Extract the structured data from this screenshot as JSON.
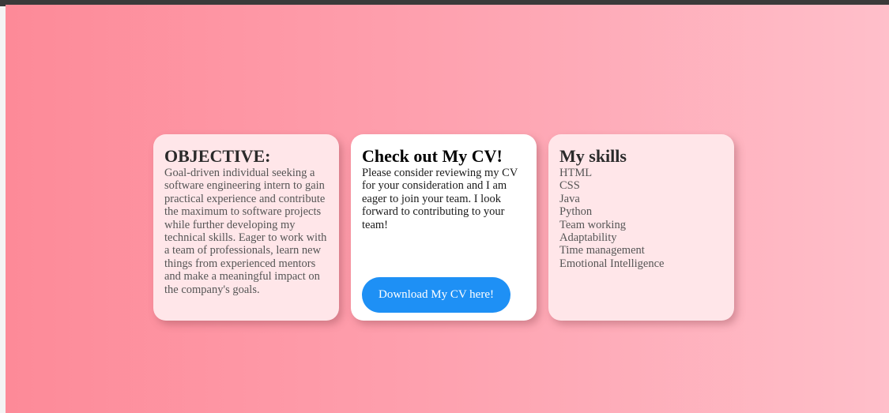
{
  "colors": {
    "background_gradient_start": "#fd8a98",
    "background_gradient_end": "#ffbfca",
    "card_pale": "#ffe6e9",
    "card_white": "#ffffff",
    "button": "#1e90f5",
    "button_text": "#ffffff"
  },
  "objective": {
    "title": "OBJECTIVE:",
    "text": "Goal-driven individual seeking a software engineering intern to gain practical experience and contribute the maximum to software projects while further developing my technical skills. Eager to work with a team of professionals, learn new things from experienced mentors and make a meaningful impact on the company's goals."
  },
  "cv": {
    "title": "Check out My CV!",
    "text": "Please consider reviewing my CV for your consideration and I am eager to join your team. I look forward to contributing to your team!",
    "button_label": "Download My CV here!"
  },
  "skills": {
    "title": "My skills",
    "items": [
      "HTML",
      "CSS",
      "Java",
      "Python",
      "Team working",
      "Adaptability",
      "Time management",
      "Emotional Intelligence"
    ]
  }
}
